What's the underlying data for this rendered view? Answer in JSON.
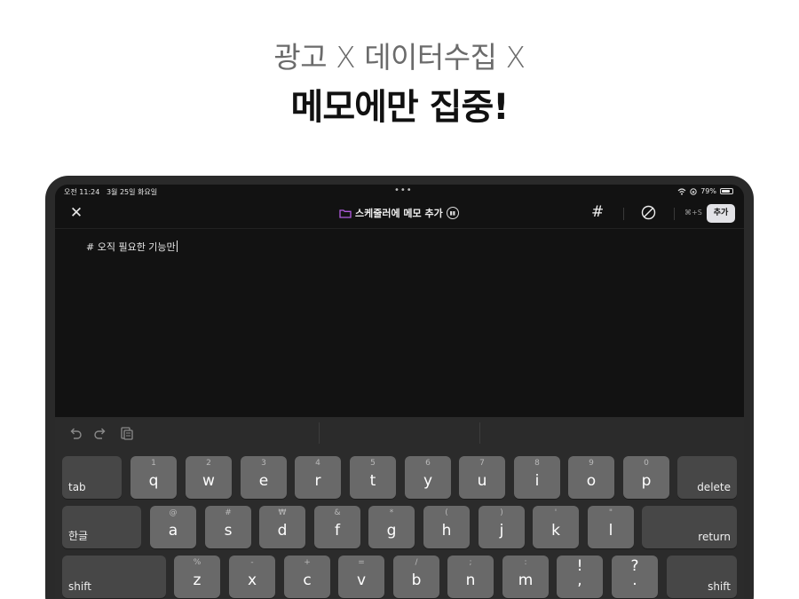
{
  "promo": {
    "subtitle": "광고 X 데이터수집 X",
    "title": "메모에만 집중!"
  },
  "status_bar": {
    "time_date": "오전 11:24   3월 25일 화요일",
    "dots": "•••",
    "battery_text": "79%",
    "battery_level": 0.79
  },
  "toolbar": {
    "close_icon": "x-icon",
    "title": "스케줄러에 메모 추가",
    "hash_label": "#",
    "shortcut_label": "⌘+S",
    "add_label": "추가",
    "folder_color": "#b15be0"
  },
  "editor": {
    "text": "# 오직 필요한 기능만"
  },
  "keyboard": {
    "row1": [
      {
        "type": "func",
        "label": "tab"
      },
      {
        "hint": "1",
        "label": "q"
      },
      {
        "hint": "2",
        "label": "w"
      },
      {
        "hint": "3",
        "label": "e"
      },
      {
        "hint": "4",
        "label": "r"
      },
      {
        "hint": "5",
        "label": "t"
      },
      {
        "hint": "6",
        "label": "y"
      },
      {
        "hint": "7",
        "label": "u"
      },
      {
        "hint": "8",
        "label": "i"
      },
      {
        "hint": "9",
        "label": "o"
      },
      {
        "hint": "0",
        "label": "p"
      },
      {
        "type": "func",
        "label": "delete"
      }
    ],
    "row2": [
      {
        "type": "func",
        "label": "한글"
      },
      {
        "hint": "@",
        "label": "a"
      },
      {
        "hint": "#",
        "label": "s"
      },
      {
        "hint": "₩",
        "label": "d"
      },
      {
        "hint": "&",
        "label": "f"
      },
      {
        "hint": "*",
        "label": "g"
      },
      {
        "hint": "(",
        "label": "h"
      },
      {
        "hint": ")",
        "label": "j"
      },
      {
        "hint": "'",
        "label": "k"
      },
      {
        "hint": "\"",
        "label": "l"
      },
      {
        "type": "func",
        "label": "return"
      }
    ],
    "row3": [
      {
        "type": "func",
        "label": "shift"
      },
      {
        "hint": "%",
        "label": "z"
      },
      {
        "hint": "-",
        "label": "x"
      },
      {
        "hint": "+",
        "label": "c"
      },
      {
        "hint": "=",
        "label": "v"
      },
      {
        "hint": "/",
        "label": "b"
      },
      {
        "hint": ";",
        "label": "n"
      },
      {
        "hint": ":",
        "label": "m"
      },
      {
        "top": "!",
        "label": ","
      },
      {
        "top": "?",
        "label": "."
      },
      {
        "type": "func",
        "label": "shift"
      }
    ]
  }
}
